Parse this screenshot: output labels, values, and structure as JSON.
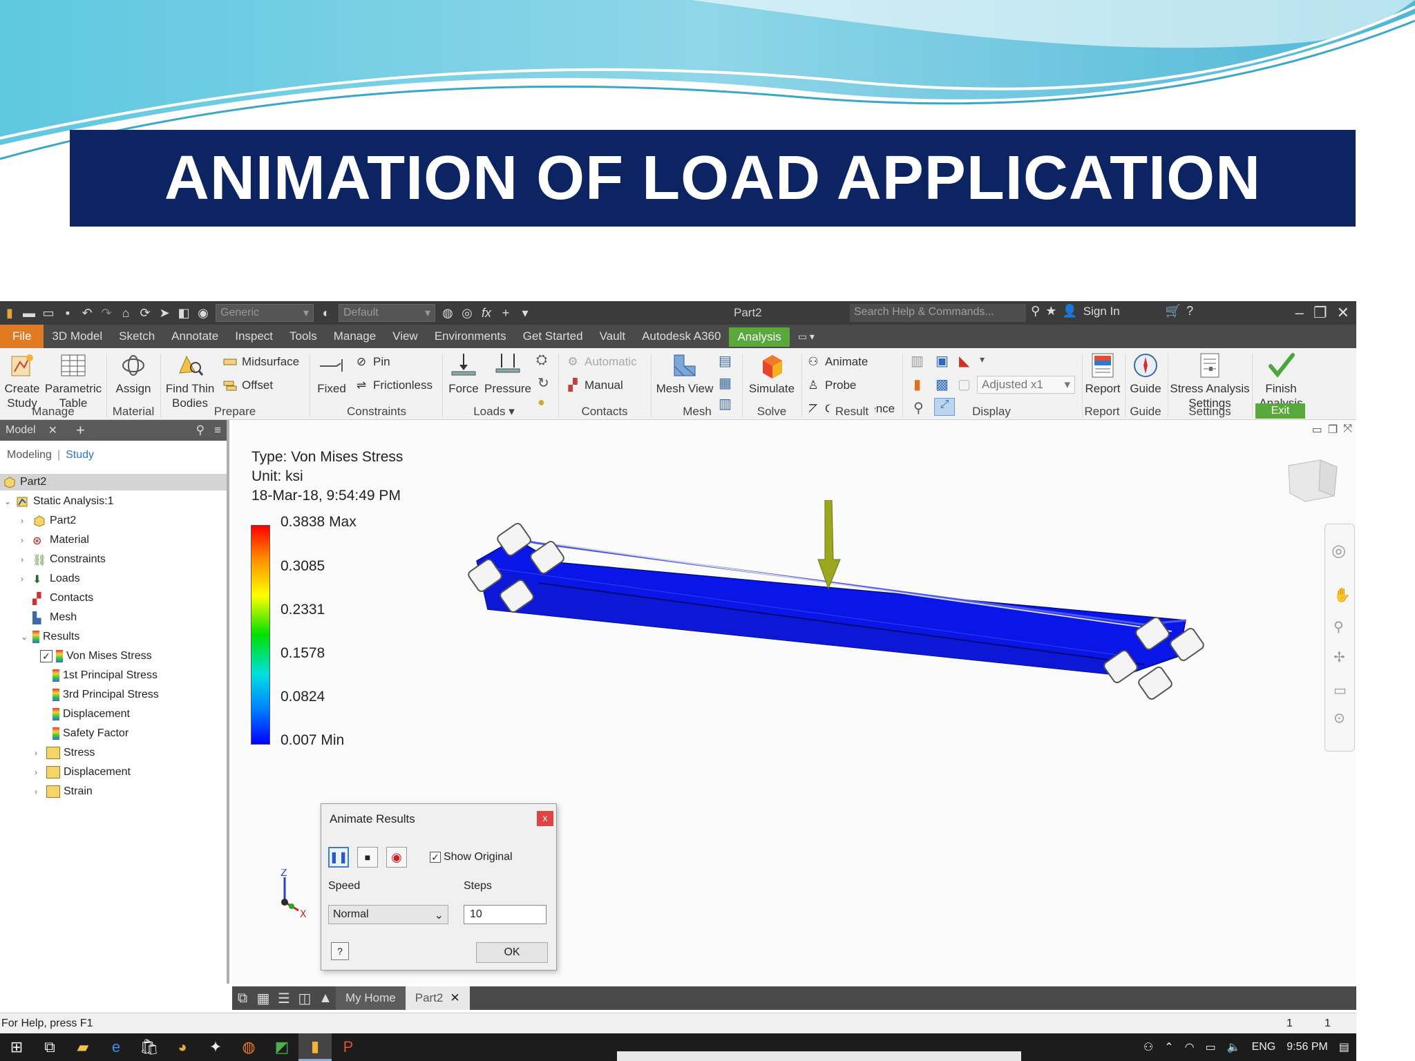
{
  "slide": {
    "title": "ANIMATION OF LOAD APPLICATION"
  },
  "qat": {
    "material_combo": "Generic",
    "appearance_combo": "Default",
    "fx_label": "fx",
    "doc_title": "Part2",
    "search_placeholder": "Search Help & Commands...",
    "sign_in": "Sign In"
  },
  "menubar": {
    "tabs": [
      "File",
      "3D Model",
      "Sketch",
      "Annotate",
      "Inspect",
      "Tools",
      "Manage",
      "View",
      "Environments",
      "Get Started",
      "Vault",
      "Autodesk A360",
      "Analysis"
    ],
    "active": "Analysis"
  },
  "ribbon": {
    "create_study": "Create\nStudy",
    "parametric_table": "Parametric\nTable",
    "assign": "Assign",
    "find_thin_bodies": "Find Thin\nBodies",
    "midsurface": "Midsurface",
    "offset": "Offset",
    "fixed": "Fixed",
    "pin": "Pin",
    "frictionless": "Frictionless",
    "force": "Force",
    "pressure": "Pressure",
    "automatic": "Automatic",
    "manual": "Manual",
    "mesh_view": "Mesh View",
    "simulate": "Simulate",
    "animate": "Animate",
    "probe": "Probe",
    "convergence": "Convergence",
    "adjusted": "Adjusted x1",
    "report": "Report",
    "guide": "Guide",
    "stress_settings": "Stress Analysis\nSettings",
    "finish_analysis": "Finish\nAnalysis",
    "panels": {
      "manage": "Manage",
      "material": "Material",
      "prepare": "Prepare",
      "constraints": "Constraints",
      "loads": "Loads",
      "contacts": "Contacts",
      "mesh": "Mesh",
      "solve": "Solve",
      "result": "Result",
      "display": "Display",
      "report": "Report",
      "guide": "Guide",
      "settings": "Settings",
      "exit": "Exit"
    }
  },
  "browser": {
    "tab": "Model",
    "modeling": "Modeling",
    "study": "Study",
    "tree": [
      {
        "label": "Part2"
      },
      {
        "label": "Static Analysis:1"
      },
      {
        "label": "Part2"
      },
      {
        "label": "Material"
      },
      {
        "label": "Constraints"
      },
      {
        "label": "Loads"
      },
      {
        "label": "Contacts"
      },
      {
        "label": "Mesh"
      },
      {
        "label": "Results"
      },
      {
        "label": "Von Mises Stress"
      },
      {
        "label": "1st Principal Stress"
      },
      {
        "label": "3rd Principal Stress"
      },
      {
        "label": "Displacement"
      },
      {
        "label": "Safety Factor"
      },
      {
        "label": "Stress"
      },
      {
        "label": "Displacement"
      },
      {
        "label": "Strain"
      }
    ]
  },
  "legend": {
    "type": "Type: Von Mises Stress",
    "unit": "Unit: ksi",
    "date": "18-Mar-18, 9:54:49 PM",
    "values": [
      "0.3838 Max",
      "0.3085",
      "0.2331",
      "0.1578",
      "0.0824",
      "0.007 Min"
    ]
  },
  "dialog": {
    "title": "Animate Results",
    "show_original": "Show Original",
    "speed_label": "Speed",
    "steps_label": "Steps",
    "speed_value": "Normal",
    "steps_value": "10",
    "ok": "OK",
    "help": "?"
  },
  "doctabs": {
    "home": "My Home",
    "part": "Part2"
  },
  "status": {
    "help": "For Help, press F1",
    "n1": "1",
    "n2": "1"
  },
  "taskbar": {
    "lang": "ENG",
    "time": "9:56 PM"
  },
  "colors": {
    "title_bg": "#0c2461",
    "file_tab": "#e07b24",
    "analysis_tab": "#59a83b",
    "beam_blue": "#0a16e8"
  }
}
